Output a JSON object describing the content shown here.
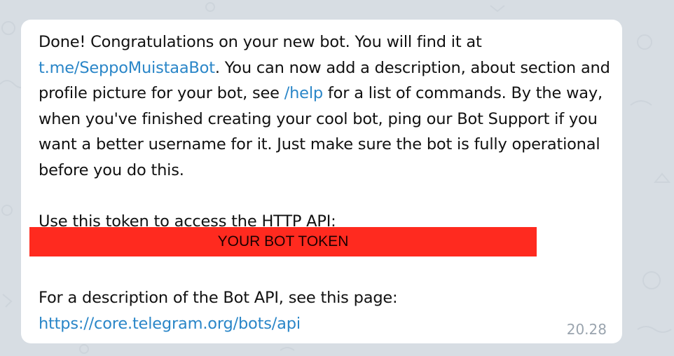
{
  "message": {
    "line1": "Done! Congratulations on your new bot. You will find it at",
    "bot_link": "t.me/SeppoMuistaaBot",
    "line2_rest": ". You can now add a description, about section and profile picture for your bot, see ",
    "help_link": "/help",
    "line3_rest": " for a list of commands. By the way, when you've finished creating your cool bot, ping our Bot Support if you want a better username for it. Just make sure the bot is fully operational before you do this.",
    "token_label": "Use this token to access the HTTP API:",
    "token_value": "YOUR BOT TOKEN",
    "api_label": "For a description of the Bot API, see this page:",
    "api_link": "https://core.telegram.org/bots/api",
    "time": "20.28"
  },
  "colors": {
    "background": "#d7dde3",
    "bubble": "#ffffff",
    "link": "#2a86c8",
    "token_redaction": "#ff2a1f",
    "timestamp": "#9aa4ae"
  }
}
